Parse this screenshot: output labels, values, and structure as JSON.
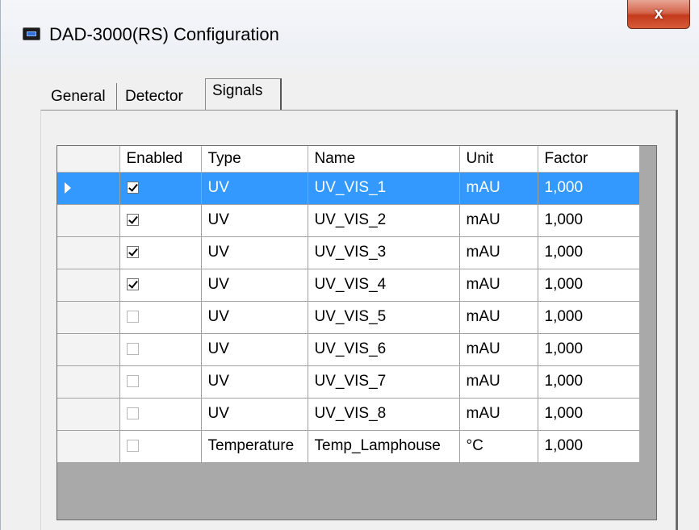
{
  "window": {
    "title": "DAD-3000(RS) Configuration",
    "close_glyph": "x"
  },
  "tabs": [
    {
      "label": "General"
    },
    {
      "label": "Detector"
    },
    {
      "label": "Signals",
      "active": true
    }
  ],
  "grid": {
    "columns": [
      "Enabled",
      "Type",
      "Name",
      "Unit",
      "Factor"
    ],
    "selected_row": 0,
    "rows": [
      {
        "enabled": true,
        "type": "UV",
        "name": "UV_VIS_1",
        "unit": "mAU",
        "factor": "1,000"
      },
      {
        "enabled": true,
        "type": "UV",
        "name": "UV_VIS_2",
        "unit": "mAU",
        "factor": "1,000"
      },
      {
        "enabled": true,
        "type": "UV",
        "name": "UV_VIS_3",
        "unit": "mAU",
        "factor": "1,000"
      },
      {
        "enabled": true,
        "type": "UV",
        "name": "UV_VIS_4",
        "unit": "mAU",
        "factor": "1,000"
      },
      {
        "enabled": false,
        "type": "UV",
        "name": "UV_VIS_5",
        "unit": "mAU",
        "factor": "1,000"
      },
      {
        "enabled": false,
        "type": "UV",
        "name": "UV_VIS_6",
        "unit": "mAU",
        "factor": "1,000"
      },
      {
        "enabled": false,
        "type": "UV",
        "name": "UV_VIS_7",
        "unit": "mAU",
        "factor": "1,000"
      },
      {
        "enabled": false,
        "type": "UV",
        "name": "UV_VIS_8",
        "unit": "mAU",
        "factor": "1,000"
      },
      {
        "enabled": false,
        "type": "Temperature",
        "name": "Temp_Lamphouse",
        "unit": "°C",
        "factor": "1,000"
      }
    ]
  },
  "colors": {
    "selection": "#3399ff",
    "grid_background": "#a9a9a9"
  }
}
